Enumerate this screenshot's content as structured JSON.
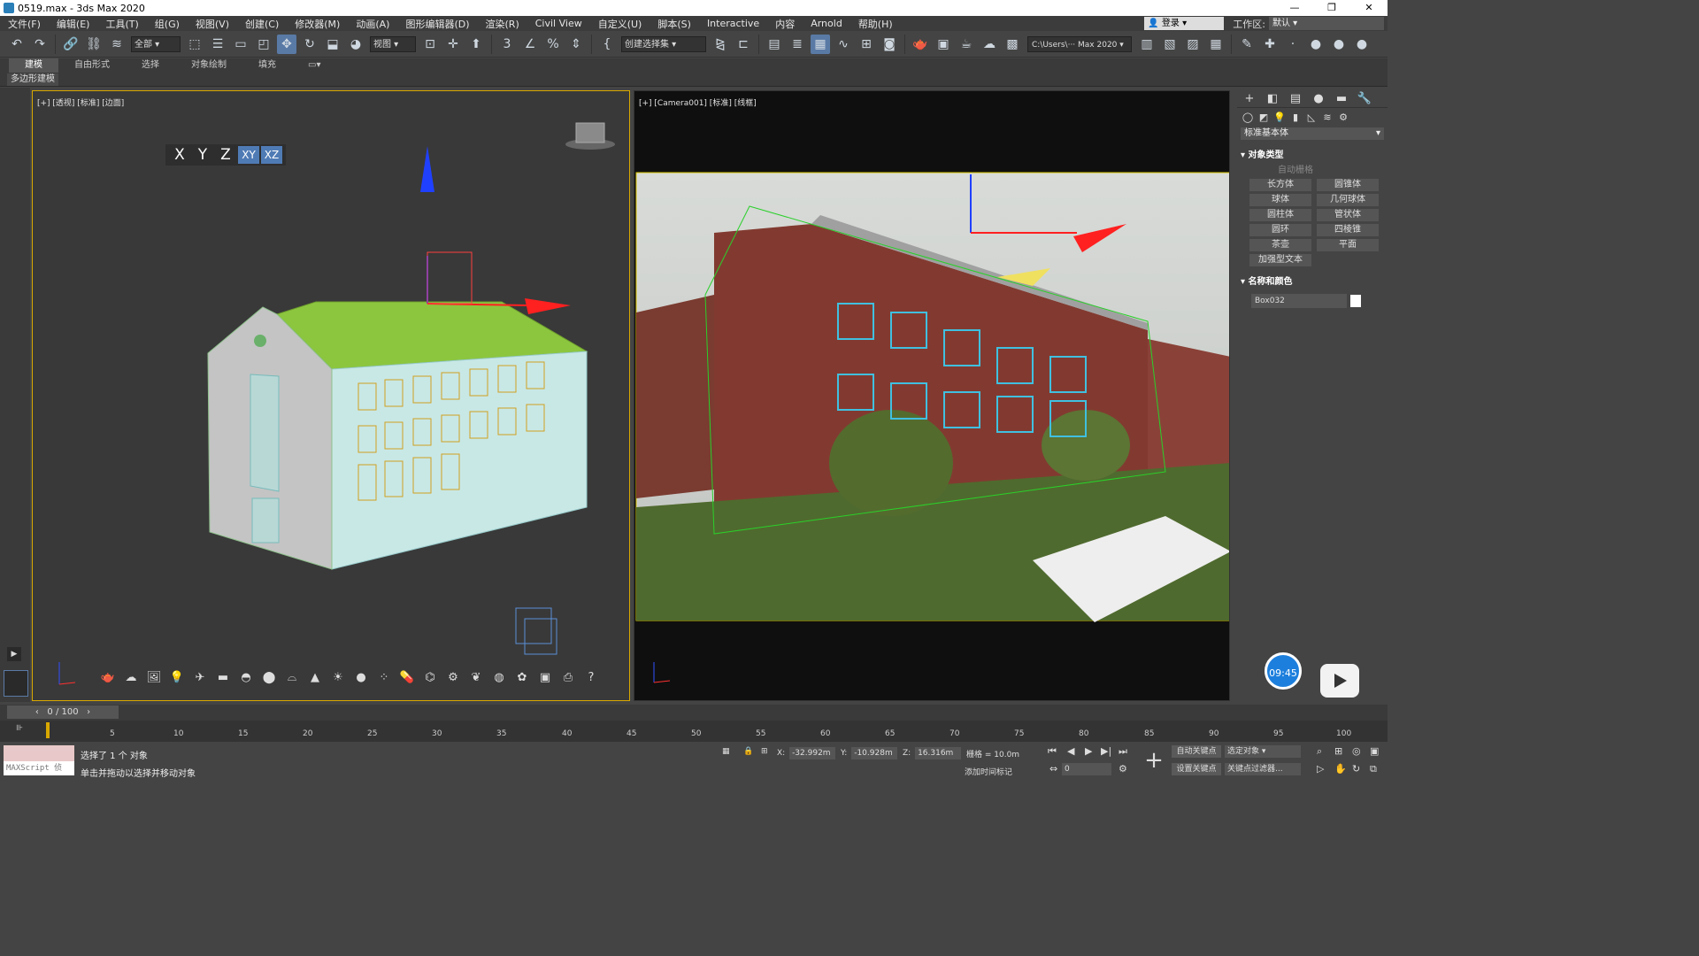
{
  "window": {
    "title": "0519.max - 3ds Max 2020",
    "minimize": "—",
    "maximize": "❐",
    "close": "✕"
  },
  "menu": {
    "items": [
      "文件(F)",
      "编辑(E)",
      "工具(T)",
      "组(G)",
      "视图(V)",
      "创建(C)",
      "修改器(M)",
      "动画(A)",
      "图形编辑器(D)",
      "渲染(R)",
      "Civil View",
      "自定义(U)",
      "脚本(S)",
      "Interactive",
      "内容",
      "Arnold",
      "帮助(H)"
    ],
    "login": "登录",
    "workspace_label": "工作区:",
    "workspace_value": "默认"
  },
  "toolbar": {
    "selection_filter": "全部",
    "ref_coord": "视图",
    "named_selection": "创建选择集",
    "project_path": "C:\\Users\\··· Max 2020"
  },
  "ribbon": {
    "tabs": [
      "建模",
      "自由形式",
      "选择",
      "对象绘制",
      "填充"
    ],
    "panel": "多边形建模"
  },
  "viewport_left": {
    "label": "[+] [透视] [标准] [边面]",
    "axis_constraints": [
      "X",
      "Y",
      "Z",
      "XY",
      "XZ"
    ]
  },
  "viewport_right": {
    "label": "[+] [Camera001] [标准] [线框]"
  },
  "command_panel": {
    "category": "标准基本体",
    "section_object_type": "对象类型",
    "autogrid": "自动栅格",
    "buttons": [
      "长方体",
      "圆锥体",
      "球体",
      "几何球体",
      "圆柱体",
      "管状体",
      "圆环",
      "四棱锥",
      "茶壶",
      "平面",
      "加强型文本"
    ],
    "section_name_color": "名称和颜色",
    "object_name": "Box032",
    "object_color": "#ffffff"
  },
  "overlay": {
    "timer": "09:45"
  },
  "timeline": {
    "frame_display": "0 / 100",
    "ticks": [
      "5",
      "10",
      "15",
      "20",
      "25",
      "30",
      "35",
      "40",
      "45",
      "50",
      "55",
      "60",
      "65",
      "70",
      "75",
      "80",
      "85",
      "90",
      "95",
      "100"
    ]
  },
  "status": {
    "maxscript": "MAXScript 侦",
    "selection": "选择了 1 个 对象",
    "prompt": "单击并拖动以选择并移动对象",
    "x": "-32.992m",
    "y": "-10.928m",
    "z": "16.316m",
    "grid": "栅格 = 10.0m",
    "add_time_tag": "添加时间标记",
    "auto_key": "自动关键点",
    "set_key": "设置关键点",
    "selected_objects": "选定对象",
    "key_filters": "关键点过滤器...",
    "current_frame": "0"
  },
  "colors": {
    "accent": "#5a7aa6",
    "viewport_border": "#d9a800",
    "timer_blue": "#1d7fdd"
  }
}
